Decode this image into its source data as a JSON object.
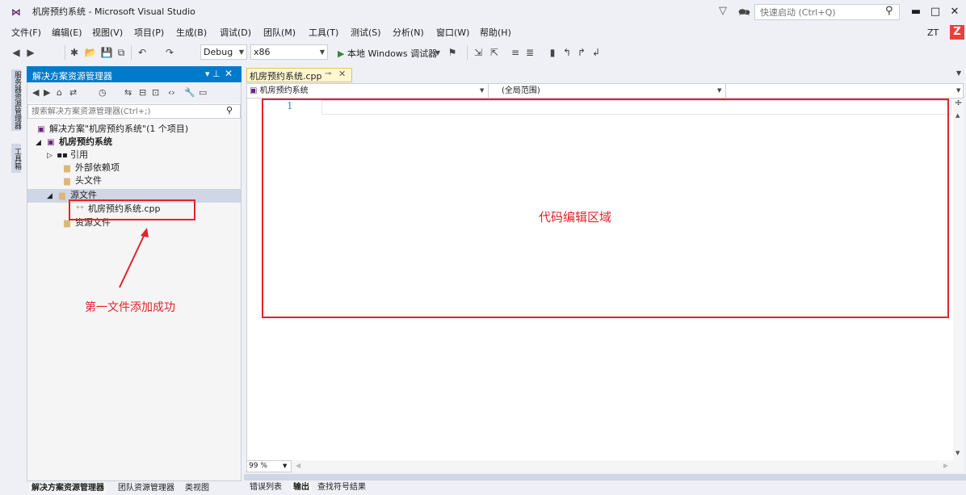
{
  "window": {
    "title": "机房预约系统 - Microsoft Visual Studio",
    "quick_launch_placeholder": "快速启动 (Ctrl+Q)",
    "account": "ZT",
    "account_badge": "Z"
  },
  "menu": [
    "文件(F)",
    "编辑(E)",
    "视图(V)",
    "项目(P)",
    "生成(B)",
    "调试(D)",
    "团队(M)",
    "工具(T)",
    "测试(S)",
    "分析(N)",
    "窗口(W)",
    "帮助(H)"
  ],
  "toolbar": {
    "config": "Debug",
    "platform": "x86",
    "debugger": "本地 Windows 调试器"
  },
  "side_tabs": [
    "服务器资源管理器",
    "工具箱"
  ],
  "solution_explorer": {
    "title": "解决方案资源管理器",
    "search_placeholder": "搜索解决方案资源管理器(Ctrl+;)",
    "tree": {
      "solution": "解决方案\"机房预约系统\"(1 个项目)",
      "project": "机房预约系统",
      "references": "引用",
      "external_deps": "外部依赖项",
      "header_files": "头文件",
      "source_files": "源文件",
      "cpp_file": "机房预约系统.cpp",
      "resource_files": "资源文件"
    },
    "bottom_tabs": [
      "解决方案资源管理器",
      "团队资源管理器",
      "类视图"
    ]
  },
  "editor": {
    "tab_label": "机房预约系统.cpp",
    "nav_project": "机房预约系统",
    "nav_scope": "(全局范围)",
    "line_number": "1",
    "zoom": "99 %"
  },
  "output_tabs": [
    "错误列表",
    "输出",
    "查找符号结果"
  ],
  "annotations": {
    "editor_label": "代码编辑区域",
    "file_label": "第一文件添加成功",
    "color": "#e0232b"
  },
  "colors": {
    "accent": "#007acc",
    "background": "#eef0f5",
    "selected_row": "#cfd6e5",
    "active_tab": "#fff7cf"
  }
}
